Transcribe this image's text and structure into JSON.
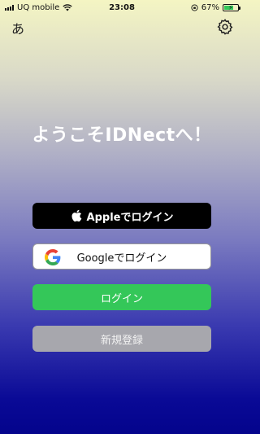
{
  "status_bar": {
    "carrier": "UQ mobile",
    "time": "23:08",
    "battery_percent": "67%",
    "battery_level": 0.67
  },
  "header": {
    "lang_label": "あ"
  },
  "welcome": {
    "title": "ようこそIDNectへ！"
  },
  "buttons": {
    "apple": "Appleでログイン",
    "google": "Googleでログイン",
    "login": "ログイン",
    "register": "新規登録"
  },
  "colors": {
    "login_green": "#34c759",
    "register_gray": "#a7a7ad",
    "apple_black": "#000000"
  }
}
